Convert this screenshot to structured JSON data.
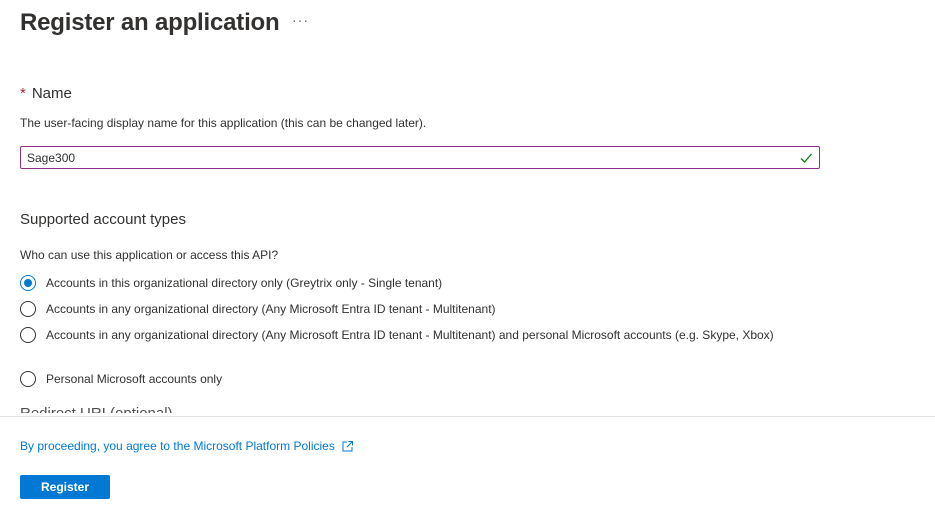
{
  "page": {
    "title": "Register an application",
    "more_label": "···"
  },
  "name_field": {
    "required_marker": "*",
    "label": "Name",
    "description": "The user-facing display name for this application (this can be changed later).",
    "value": "Sage300",
    "valid": true
  },
  "account_types": {
    "title": "Supported account types",
    "question": "Who can use this application or access this API?",
    "options": [
      {
        "label": "Accounts in this organizational directory only (Greytrix only - Single tenant)",
        "selected": true
      },
      {
        "label": "Accounts in any organizational directory (Any Microsoft Entra ID tenant - Multitenant)",
        "selected": false
      },
      {
        "label": "Accounts in any organizational directory (Any Microsoft Entra ID tenant - Multitenant) and personal Microsoft accounts (e.g. Skype, Xbox)",
        "selected": false
      },
      {
        "label": "Personal Microsoft accounts only",
        "selected": false
      }
    ]
  },
  "next_section_label": "Redirect URI (optional)",
  "footer": {
    "policy_text": "By proceeding, you agree to the Microsoft Platform Policies",
    "register_label": "Register"
  },
  "colors": {
    "accent": "#0078d4",
    "input_border": "#8a2e8a",
    "valid_check": "#107c10",
    "required": "#a4262c"
  }
}
